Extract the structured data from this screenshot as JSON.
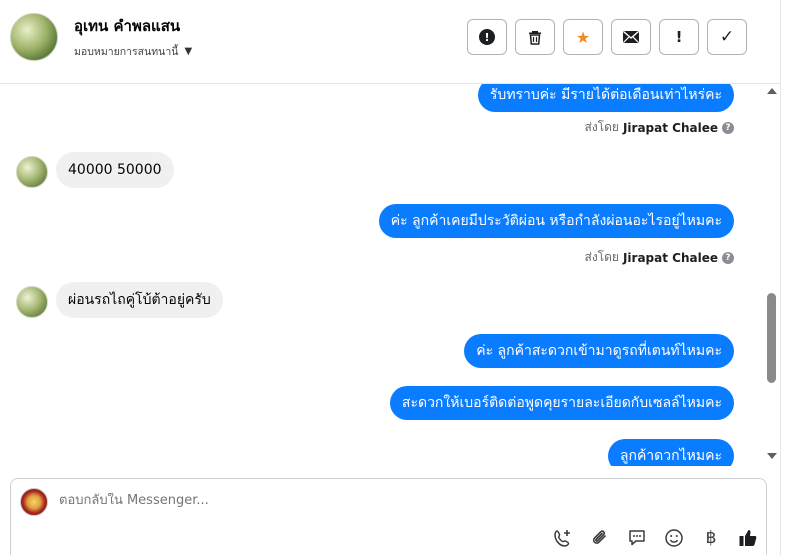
{
  "header": {
    "contact_name": "อุเทน คำพลแสน",
    "assign_label": "มอบหมายการสนทนานี้"
  },
  "actions": [
    {
      "name": "spam-button",
      "icon": "alert-circle-icon",
      "glyph": "!"
    },
    {
      "name": "delete-button",
      "icon": "trash-icon",
      "glyph": "🗑"
    },
    {
      "name": "star-button",
      "icon": "star-icon",
      "glyph": "★"
    },
    {
      "name": "mark-unread-button",
      "icon": "envelope-icon",
      "glyph": "✉"
    },
    {
      "name": "follow-up-button",
      "icon": "exclamation-icon",
      "glyph": "!"
    },
    {
      "name": "done-button",
      "icon": "check-icon",
      "glyph": "✓"
    }
  ],
  "messages": {
    "m1": "รับทราบค่ะ มีรายได้ต่อเดือนเท่าไหร่คะ",
    "sent_by_1_prefix": "ส่งโดย",
    "sent_by_1_name": "Jirapat Chalee",
    "m2": "40000  50000",
    "m3": "ค่ะ ลูกค้าเคยมีประวัติผ่อน หรือกำลังผ่อนอะไรอยู่ไหมคะ",
    "sent_by_2_prefix": "ส่งโดย",
    "sent_by_2_name": "Jirapat Chalee",
    "m4": "ผ่อนรถไถคู่โบ้ต้าอยู่ครับ",
    "m5": "ค่ะ ลูกค้าสะดวกเข้ามาดูรถที่เตนท์ไหมคะ",
    "m6": "สะดวกให้เบอร์ติดต่อพูดคุยรายละเอียดกับเซลล์ไหมคะ",
    "m7": "ลูกค้าดวกไหมคะ"
  },
  "composer": {
    "placeholder": "ตอบกลับใน Messenger...",
    "tools": [
      "add-contact-icon",
      "paperclip-icon",
      "saved-replies-icon",
      "emoji-icon",
      "baht-icon",
      "thumbs-up-icon"
    ],
    "baht_glyph": "฿"
  },
  "colors": {
    "outgoing_bubble": "#0a7cff",
    "incoming_bubble": "#f0f0f0",
    "star": "#f08c1e"
  }
}
